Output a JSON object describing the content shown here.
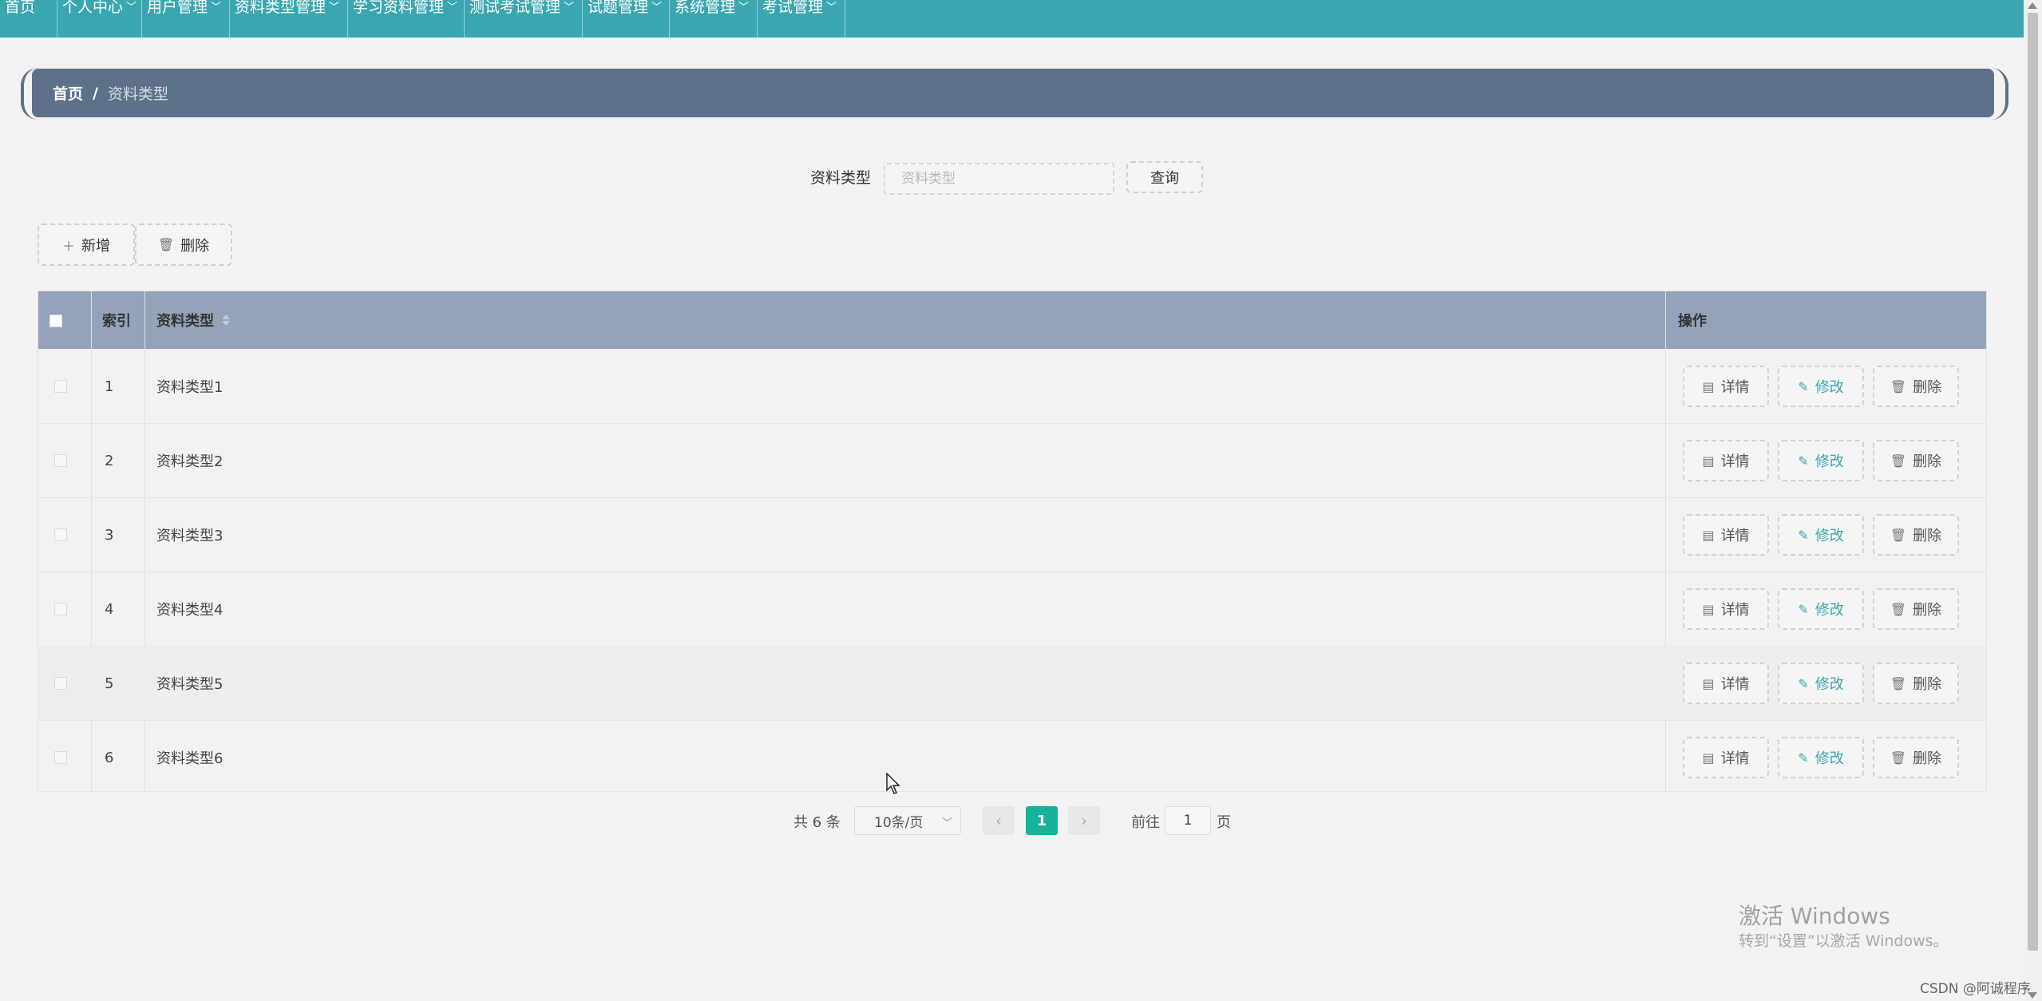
{
  "nav": {
    "items": [
      {
        "label": "首页",
        "has_dropdown": false
      },
      {
        "label": "个人中心",
        "has_dropdown": true
      },
      {
        "label": "用户管理",
        "has_dropdown": true
      },
      {
        "label": "资料类型管理",
        "has_dropdown": true
      },
      {
        "label": "学习资料管理",
        "has_dropdown": true
      },
      {
        "label": "测试考试管理",
        "has_dropdown": true
      },
      {
        "label": "试题管理",
        "has_dropdown": true
      },
      {
        "label": "系统管理",
        "has_dropdown": true
      },
      {
        "label": "考试管理",
        "has_dropdown": true
      }
    ]
  },
  "breadcrumb": {
    "home": "首页",
    "separator": "/",
    "current": "资料类型"
  },
  "search": {
    "label": "资料类型",
    "placeholder": "资料类型",
    "value": "",
    "button": "查询"
  },
  "toolbar": {
    "add": "新增",
    "delete": "删除"
  },
  "table": {
    "headers": {
      "index": "索引",
      "type": "资料类型",
      "actions": "操作"
    },
    "rows": [
      {
        "index": "1",
        "type": "资料类型1"
      },
      {
        "index": "2",
        "type": "资料类型2"
      },
      {
        "index": "3",
        "type": "资料类型3"
      },
      {
        "index": "4",
        "type": "资料类型4"
      },
      {
        "index": "5",
        "type": "资料类型5"
      },
      {
        "index": "6",
        "type": "资料类型6"
      }
    ],
    "row_actions": {
      "detail": "详情",
      "edit": "修改",
      "delete": "删除"
    }
  },
  "pagination": {
    "total": "共 6 条",
    "page_size": "10条/页",
    "current_page": "1",
    "goto_label": "前往",
    "goto_value": "1",
    "page_suffix": "页"
  },
  "watermark": {
    "title": "激活 Windows",
    "subtitle": "转到“设置”以激活 Windows。"
  },
  "footer_credit": "CSDN @阿诚程序",
  "colors": {
    "nav_bg": "#3aa7b0",
    "breadcrumb_bg": "#5e718a",
    "table_header_bg": "#94a3b9",
    "pager_active": "#14b39a"
  }
}
